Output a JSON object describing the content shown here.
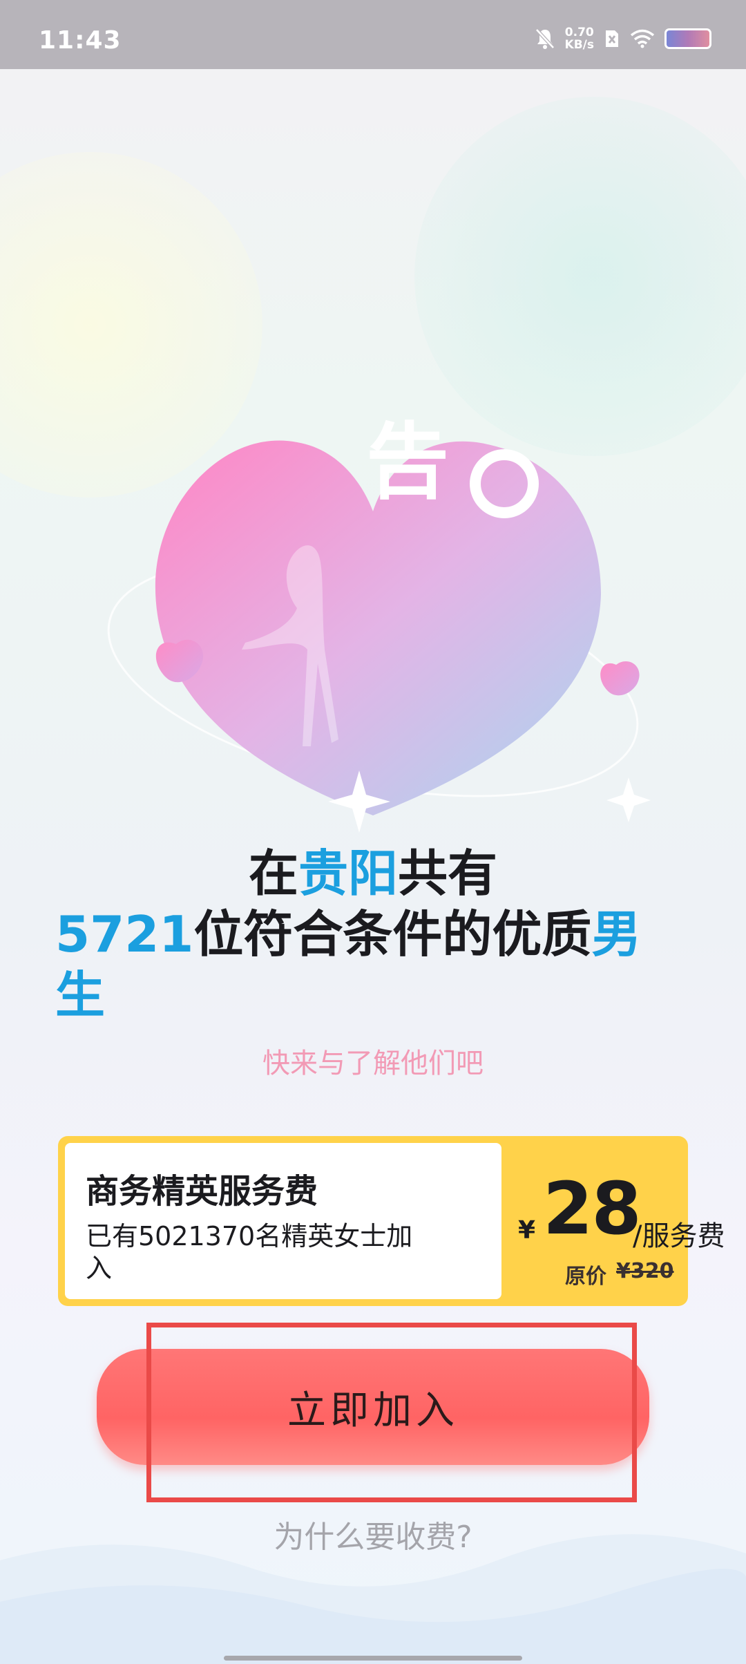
{
  "status_bar": {
    "time": "11:43",
    "speed_value": "0.70",
    "speed_unit": "KB/s",
    "icons": [
      "mute-icon",
      "sim-icon",
      "wifi-icon",
      "battery-icon"
    ]
  },
  "headline": {
    "part1": "在",
    "city": "贵阳",
    "part2": "共有",
    "count": "5721",
    "part3": "位符合条件的优质",
    "gender": "男生"
  },
  "subtitle": "快来与了解他们吧",
  "service_card": {
    "title": "商务精英服务费",
    "description": "已有5021370名精英女士加入",
    "currency": "¥",
    "price": "28",
    "price_unit": "/服务费",
    "original_label": "原价",
    "original_price": "¥320"
  },
  "join_button": {
    "label": "立即加入"
  },
  "why_link": "为什么要收费?",
  "colors": {
    "accent_blue": "#1b9fdf",
    "button_red": "#ff6b6b",
    "card_yellow": "#ffd24a",
    "subtitle_pink": "#f29ab5"
  }
}
